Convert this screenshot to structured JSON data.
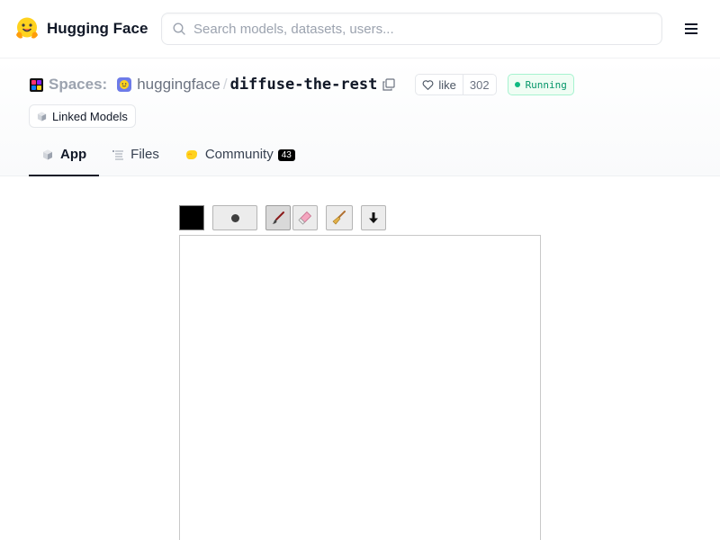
{
  "brand": {
    "name": "Hugging Face"
  },
  "search": {
    "placeholder": "Search models, datasets, users..."
  },
  "repo": {
    "section_label": "Spaces:",
    "owner": "huggingface",
    "separator": "/",
    "name": "diffuse-the-rest",
    "like_label": "like",
    "like_count": "302",
    "status": "Running",
    "status_color": "#10b981"
  },
  "linked_models_label": "Linked Models",
  "tabs": [
    {
      "label": "App",
      "icon": "cube-icon",
      "active": true
    },
    {
      "label": "Files",
      "icon": "files-icon",
      "active": false
    },
    {
      "label": "Community",
      "icon": "community-icon",
      "active": false,
      "badge": "43"
    }
  ],
  "sketch": {
    "current_color": "#000000",
    "tools": [
      {
        "name": "color-swatch"
      },
      {
        "name": "brush-size",
        "icon": "dot-icon"
      },
      {
        "name": "pen-tool",
        "icon": "paintbrush-icon",
        "active": true
      },
      {
        "name": "eraser-tool",
        "icon": "eraser-icon"
      },
      {
        "name": "clear-tool",
        "icon": "broom-icon"
      },
      {
        "name": "download-tool",
        "icon": "down-arrow-icon"
      }
    ]
  }
}
